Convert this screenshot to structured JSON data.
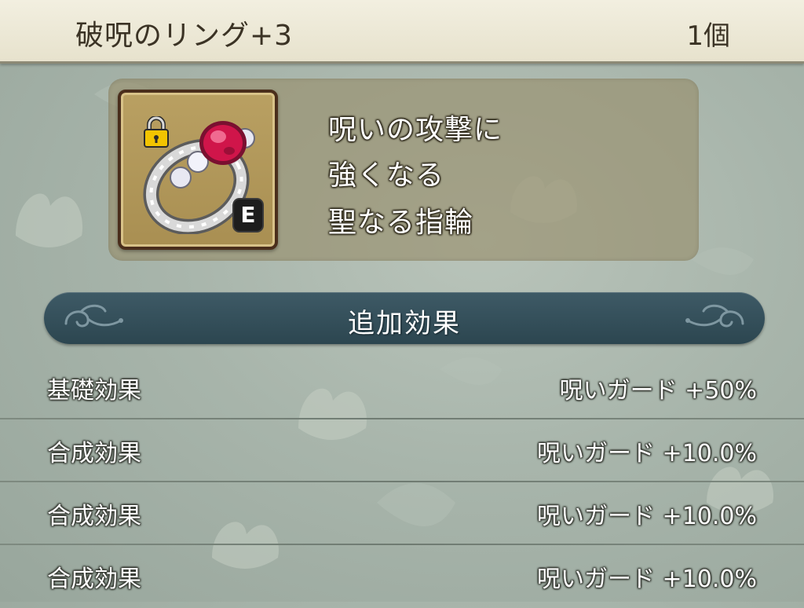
{
  "header": {
    "item_name": "破呪のリング+3",
    "item_count": "1個"
  },
  "item": {
    "icon": "ring-icon",
    "locked": true,
    "lock_icon": "padlock-icon",
    "equipped_badge": "E",
    "description": [
      "呪いの攻撃に",
      "強くなる",
      "聖なる指輪"
    ]
  },
  "section": {
    "title": "追加効果"
  },
  "effects": [
    {
      "label": "基礎効果",
      "value": "呪いガード +50%"
    },
    {
      "label": "合成効果",
      "value": "呪いガード +10.0%"
    },
    {
      "label": "合成効果",
      "value": "呪いガード +10.0%"
    },
    {
      "label": "合成効果",
      "value": "呪いガード +10.0%"
    }
  ],
  "colors": {
    "header_bg": "#efebdb",
    "section_bar": "#35505b",
    "gem": "#d0154a",
    "lock": "#f2c400"
  }
}
